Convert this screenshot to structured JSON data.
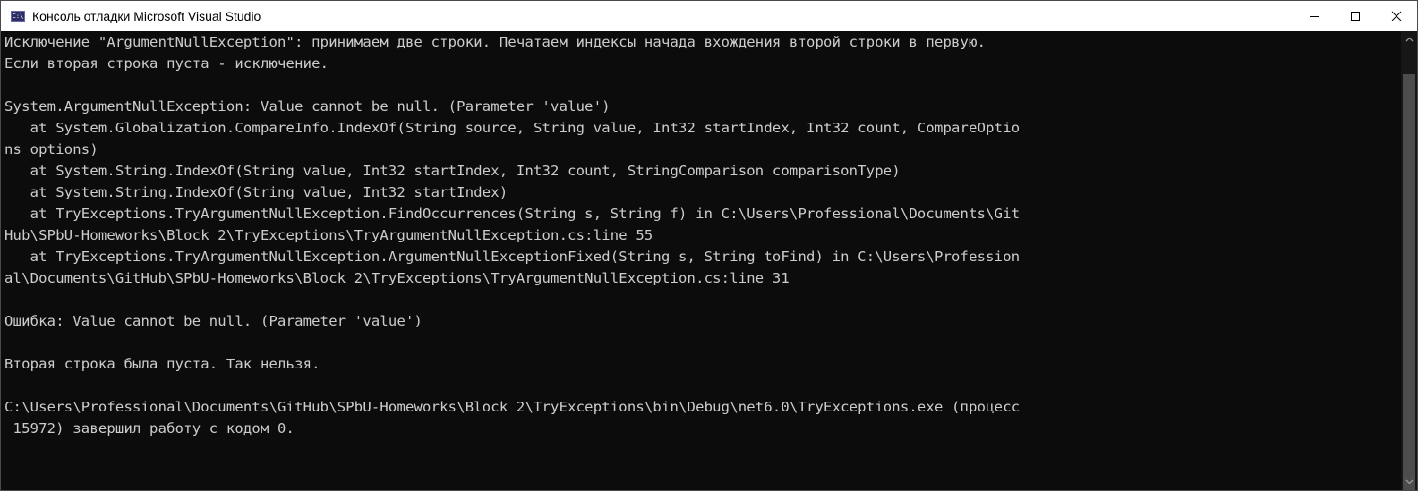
{
  "window": {
    "title": "Консоль отладки Microsoft Visual Studio",
    "icon": "console-app-icon",
    "icon_glyph": "C:\\",
    "controls": [
      "minimize-icon",
      "maximize-icon",
      "close-icon"
    ]
  },
  "console": {
    "lines": [
      "Исключение \"ArgumentNullException\": принимаем две строки. Печатаем индексы начада вхождения второй строки в первую.",
      "Если вторая строка пуста - исключение.",
      "",
      "System.ArgumentNullException: Value cannot be null. (Parameter 'value')",
      "   at System.Globalization.CompareInfo.IndexOf(String source, String value, Int32 startIndex, Int32 count, CompareOptio",
      "ns options)",
      "   at System.String.IndexOf(String value, Int32 startIndex, Int32 count, StringComparison comparisonType)",
      "   at System.String.IndexOf(String value, Int32 startIndex)",
      "   at TryExceptions.TryArgumentNullException.FindOccurrences(String s, String f) in C:\\Users\\Professional\\Documents\\Git",
      "Hub\\SPbU-Homeworks\\Block 2\\TryExceptions\\TryArgumentNullException.cs:line 55",
      "   at TryExceptions.TryArgumentNullException.ArgumentNullExceptionFixed(String s, String toFind) in C:\\Users\\Profession",
      "al\\Documents\\GitHub\\SPbU-Homeworks\\Block 2\\TryExceptions\\TryArgumentNullException.cs:line 31",
      "",
      "Ошибка: Value cannot be null. (Parameter 'value')",
      "",
      "Вторая строка была пуста. Так нельзя.",
      "",
      "C:\\Users\\Professional\\Documents\\GitHub\\SPbU-Homeworks\\Block 2\\TryExceptions\\bin\\Debug\\net6.0\\TryExceptions.exe (процесс",
      " 15972) завершил работу с кодом 0."
    ]
  },
  "colors": {
    "console_bg": "#0c0c0c",
    "console_fg": "#cccccc",
    "titlebar_bg": "#ffffff"
  }
}
